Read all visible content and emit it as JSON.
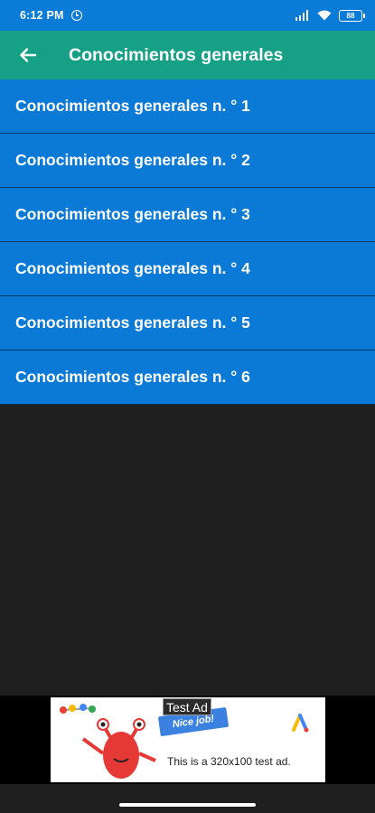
{
  "status_bar": {
    "time": "6:12 PM",
    "battery": "88",
    "icons": [
      "alarm-icon",
      "signal-icon",
      "wifi-icon",
      "battery-icon"
    ]
  },
  "app_bar": {
    "title": "Conocimientos generales",
    "back_icon": "arrow-left-icon",
    "color": "#16a085"
  },
  "list": {
    "color": "#0b7ad6",
    "items": [
      {
        "label": "Conocimientos generales n. ° 1"
      },
      {
        "label": "Conocimientos generales n. ° 2"
      },
      {
        "label": "Conocimientos generales n. ° 3"
      },
      {
        "label": "Conocimientos generales n. ° 4"
      },
      {
        "label": "Conocimientos generales n. ° 5"
      },
      {
        "label": "Conocimientos generales n. ° 6"
      }
    ]
  },
  "ad": {
    "label": "Test Ad",
    "flag_text": "Nice job!",
    "text": "This is a 320x100 test ad."
  }
}
